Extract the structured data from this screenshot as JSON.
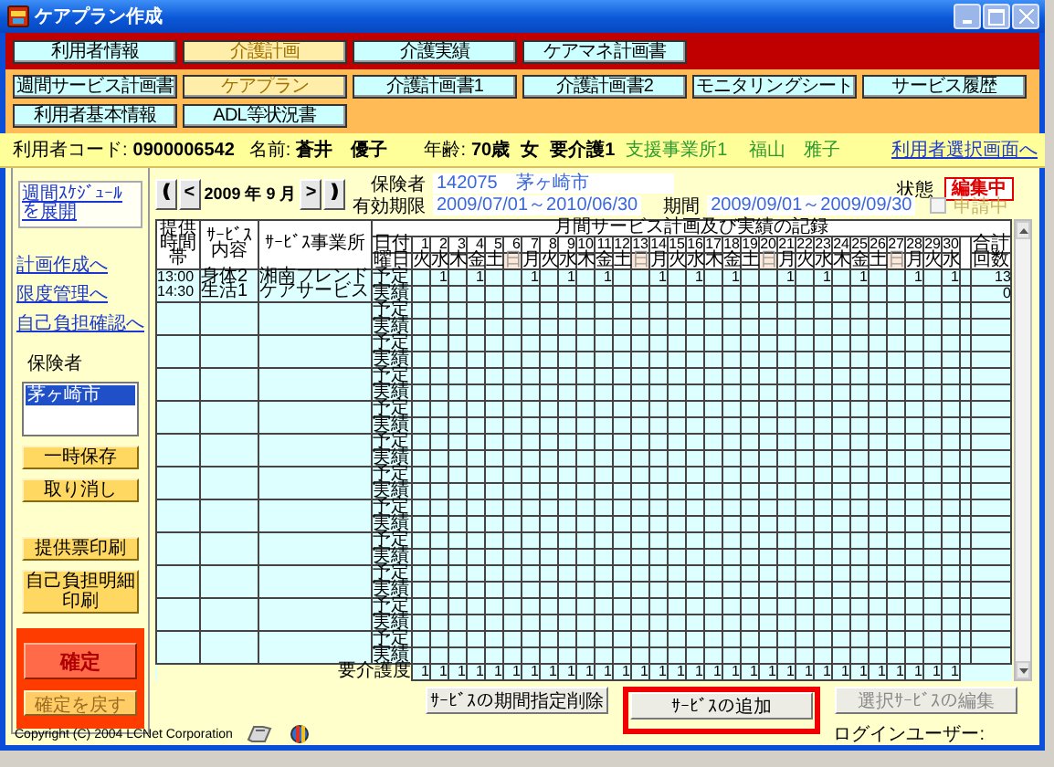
{
  "window": {
    "title": "ケアプラン作成"
  },
  "main_tabs": [
    {
      "label": "利用者情報",
      "selected": false
    },
    {
      "label": "介護計画",
      "selected": true
    },
    {
      "label": "介護実績",
      "selected": false
    },
    {
      "label": "ケアマネ計画書",
      "selected": false
    }
  ],
  "sub_tabs": [
    {
      "label": "週間サービス計画書",
      "selected": false
    },
    {
      "label": "ケアプラン",
      "selected": true
    },
    {
      "label": "介護計画書1",
      "selected": false
    },
    {
      "label": "介護計画書2",
      "selected": false
    },
    {
      "label": "モニタリングシート",
      "selected": false
    },
    {
      "label": "サービス履歴",
      "selected": false
    },
    {
      "label": "利用者基本情報",
      "selected": false
    },
    {
      "label": "ADL等状況書",
      "selected": false
    }
  ],
  "client": {
    "code_label": "利用者コード:",
    "code": "0900006542",
    "name_label": "名前:",
    "name": "蒼井　優子",
    "age_label": "年齢:",
    "age": "70歳",
    "sex": "女",
    "care_level": "要介護1",
    "office": "支援事業所1",
    "care_manager": "福山　雅子",
    "switch_link": "利用者選択画面へ"
  },
  "sidebar": {
    "schedule_link": "週間ｽｹｼﾞｭｰﾙを展開",
    "links": [
      "計画作成へ",
      "限度管理へ",
      "自己負担確認へ"
    ],
    "insurer_label": "保険者",
    "insurers": [
      {
        "label": "茅ヶ崎市",
        "selected": true
      }
    ],
    "buttons": [
      "一時保存",
      "取り消し"
    ],
    "print_buttons": [
      "提供票印刷",
      "自己負担明細印刷"
    ],
    "confirm": {
      "label": "確定",
      "disabled": false
    },
    "undo_confirm": {
      "label": "確定を戻す",
      "disabled": true
    }
  },
  "month_nav": {
    "first": "❪",
    "prev": "<",
    "month": "2009 年 9 月",
    "next": ">",
    "last": "❫"
  },
  "plan": {
    "insurer_label": "保険者",
    "insurer_no": "142075",
    "insurer_name": "茅ヶ崎市",
    "valid_label": "有効期限",
    "valid": "2009/07/01～2010/06/30",
    "period_label": "期間",
    "period": "2009/09/01～2009/09/30",
    "applying": {
      "label": "申請中",
      "checked": false,
      "disabled": true
    },
    "status_label": "状態",
    "status": "編集中"
  },
  "table": {
    "title": "月間サービス計画及び実績の記録",
    "columns": [
      "提供時間帯",
      "ｻｰﾋﾞｽ内容",
      "ｻｰﾋﾞｽ事業所"
    ],
    "date_label": "日付",
    "weekday_label": "曜日",
    "total_label": "合計",
    "count_label": "回数",
    "days": [
      {
        "date": "1",
        "weekday": "火",
        "sunday": false
      },
      {
        "date": "2",
        "weekday": "水",
        "sunday": false
      },
      {
        "date": "3",
        "weekday": "木",
        "sunday": false
      },
      {
        "date": "4",
        "weekday": "金",
        "sunday": false
      },
      {
        "date": "5",
        "weekday": "土",
        "sunday": false
      },
      {
        "date": "6",
        "weekday": "日",
        "sunday": true
      },
      {
        "date": "7",
        "weekday": "月",
        "sunday": false
      },
      {
        "date": "8",
        "weekday": "火",
        "sunday": false
      },
      {
        "date": "9",
        "weekday": "水",
        "sunday": false
      },
      {
        "date": "10",
        "weekday": "木",
        "sunday": false
      },
      {
        "date": "11",
        "weekday": "金",
        "sunday": false
      },
      {
        "date": "12",
        "weekday": "土",
        "sunday": false
      },
      {
        "date": "13",
        "weekday": "日",
        "sunday": true
      },
      {
        "date": "14",
        "weekday": "月",
        "sunday": false
      },
      {
        "date": "15",
        "weekday": "火",
        "sunday": false
      },
      {
        "date": "16",
        "weekday": "水",
        "sunday": false
      },
      {
        "date": "17",
        "weekday": "木",
        "sunday": false
      },
      {
        "date": "18",
        "weekday": "金",
        "sunday": false
      },
      {
        "date": "19",
        "weekday": "土",
        "sunday": false
      },
      {
        "date": "20",
        "weekday": "日",
        "sunday": true
      },
      {
        "date": "21",
        "weekday": "月",
        "sunday": false
      },
      {
        "date": "22",
        "weekday": "火",
        "sunday": false
      },
      {
        "date": "23",
        "weekday": "水",
        "sunday": false
      },
      {
        "date": "24",
        "weekday": "木",
        "sunday": false
      },
      {
        "date": "25",
        "weekday": "金",
        "sunday": false
      },
      {
        "date": "26",
        "weekday": "土",
        "sunday": false
      },
      {
        "date": "27",
        "weekday": "日",
        "sunday": true
      },
      {
        "date": "28",
        "weekday": "月",
        "sunday": false
      },
      {
        "date": "29",
        "weekday": "火",
        "sunday": false
      },
      {
        "date": "30",
        "weekday": "水",
        "sunday": false
      }
    ],
    "services": [
      {
        "start": "13:00",
        "end": "14:30",
        "content": "身体2生活1",
        "office": "湘南フレンドケアサービス",
        "plan_label": "予定",
        "result_label": "実績",
        "plan": [
          {
            "kind": "blank"
          },
          {
            "kind": "count",
            "count": "1"
          },
          {
            "kind": "blank"
          },
          {
            "kind": "count",
            "count": "1"
          },
          {
            "kind": "blank"
          },
          {
            "kind": "blank"
          },
          {
            "kind": "count",
            "count": "1"
          },
          {
            "kind": "blank"
          },
          {
            "kind": "count",
            "count": "1"
          },
          {
            "kind": "blank"
          },
          {
            "kind": "count",
            "count": "1"
          },
          {
            "kind": "blank"
          },
          {
            "kind": "blank"
          },
          {
            "kind": "count",
            "count": "1"
          },
          {
            "kind": "blank"
          },
          {
            "kind": "count",
            "count": "1"
          },
          {
            "kind": "blank"
          },
          {
            "kind": "count",
            "count": "1"
          },
          {
            "kind": "blank"
          },
          {
            "kind": "blank"
          },
          {
            "kind": "count",
            "count": "1"
          },
          {
            "kind": "blank"
          },
          {
            "kind": "count",
            "count": "1"
          },
          {
            "kind": "blank"
          },
          {
            "kind": "count",
            "count": "1"
          },
          {
            "kind": "blank"
          },
          {
            "kind": "blank"
          },
          {
            "kind": "count",
            "count": "1"
          },
          {
            "kind": "blank"
          },
          {
            "kind": "count",
            "count": "1"
          }
        ],
        "plan_total": "13",
        "result_total": "0"
      },
      {
        "plan_label": "予定",
        "result_label": "実績"
      },
      {
        "plan_label": "予定",
        "result_label": "実績"
      },
      {
        "plan_label": "予定",
        "result_label": "実績"
      },
      {
        "plan_label": "予定",
        "result_label": "実績"
      },
      {
        "plan_label": "予定",
        "result_label": "実績"
      },
      {
        "plan_label": "予定",
        "result_label": "実績"
      },
      {
        "plan_label": "予定",
        "result_label": "実績"
      },
      {
        "plan_label": "予定",
        "result_label": "実績"
      },
      {
        "plan_label": "予定",
        "result_label": "実績"
      },
      {
        "plan_label": "予定",
        "result_label": "実績"
      },
      {
        "plan_label": "予定",
        "result_label": "実績"
      }
    ],
    "care_level_row": {
      "label": "要介護度",
      "values": [
        "1",
        "1",
        "1",
        "1",
        "1",
        "1",
        "1",
        "1",
        "1",
        "1",
        "1",
        "1",
        "1",
        "1",
        "1",
        "1",
        "1",
        "1",
        "1",
        "1",
        "1",
        "1",
        "1",
        "1",
        "1",
        "1",
        "1",
        "1",
        "1",
        "1"
      ]
    }
  },
  "buttons": [
    {
      "label": "ｻｰﾋﾞｽの期間指定削除",
      "disabled": false,
      "highlighted": false
    },
    {
      "label": "ｻｰﾋﾞｽの追加",
      "disabled": false,
      "highlighted": true
    },
    {
      "label": "選択ｻｰﾋﾞｽの編集",
      "disabled": true,
      "highlighted": false
    }
  ],
  "login": {
    "label": "ログインユーザー:"
  },
  "footer": {
    "copyright": "Copyright (C) 2004 LCNet Corporation"
  }
}
